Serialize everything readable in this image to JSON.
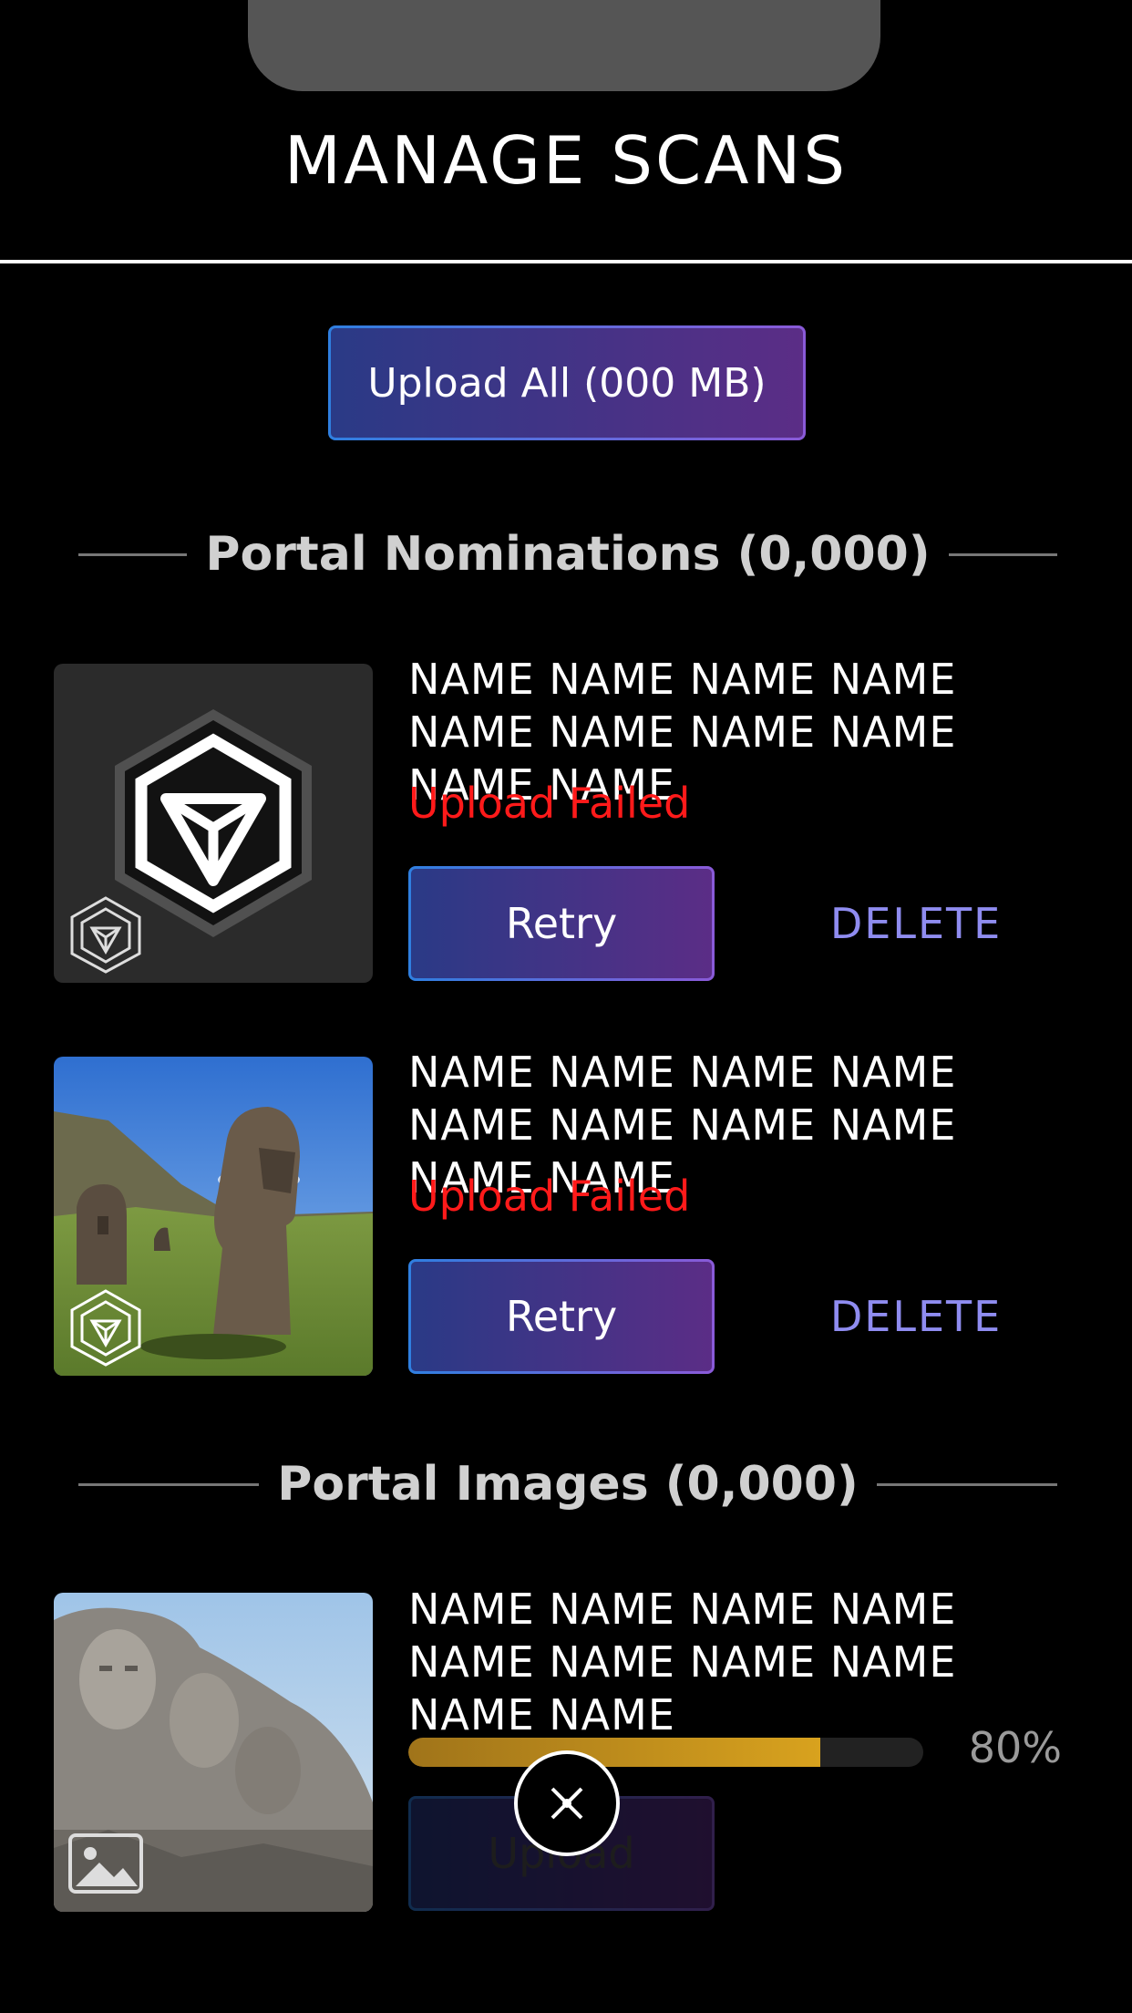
{
  "header": {
    "title": "MANAGE SCANS"
  },
  "upload_all_label": "Upload All (000 MB)",
  "sections": {
    "nominations": {
      "label": "Portal Nominations (0,000)"
    },
    "images": {
      "label": "Portal Images (0,000)"
    }
  },
  "nominations": [
    {
      "name": "NAME NAME NAME NAME NAME NAME NAME NAME NAME NAME",
      "status": "Upload Failed",
      "retry_label": "Retry",
      "delete_label": "DELETE",
      "thumbnail": "ingress-logo",
      "badge_icon": "ingress-badge-icon"
    },
    {
      "name": "NAME NAME NAME NAME NAME NAME NAME NAME NAME NAME",
      "status": "Upload Failed",
      "retry_label": "Retry",
      "delete_label": "DELETE",
      "thumbnail": "moai-statues-photo",
      "badge_icon": "ingress-badge-icon"
    }
  ],
  "images": [
    {
      "name": "NAME NAME NAME NAME NAME NAME NAME NAME NAME NAME",
      "progress": 0.8,
      "progress_label": "80%",
      "upload_label": "Upload",
      "thumbnail": "mount-rushmore-photo",
      "badge_icon": "image-icon"
    }
  ],
  "colors": {
    "error": "#ff1a1a",
    "delete": "#8f8cf0",
    "progress": "#d8a21e",
    "accent_start": "#2a3a86",
    "accent_end": "#5b2d86"
  }
}
